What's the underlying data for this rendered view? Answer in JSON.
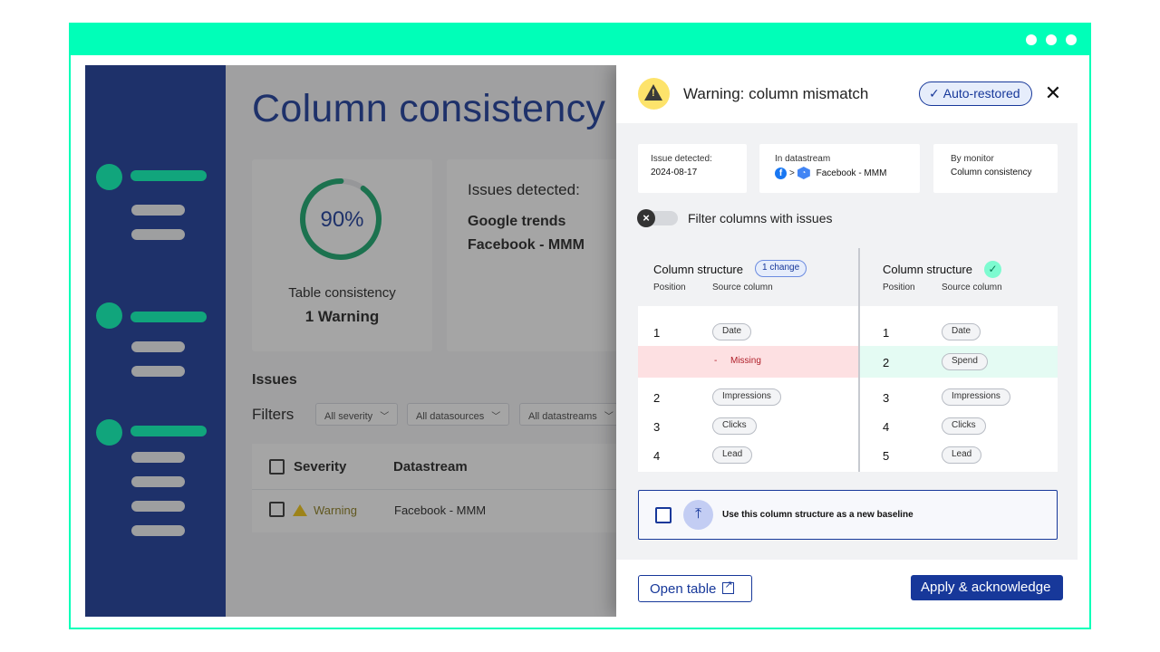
{
  "page": {
    "title": "Column consistency r",
    "consistency": {
      "percent": "90%",
      "percent_value": 0.9,
      "label": "Table consistency",
      "value": "1 Warning"
    },
    "issues_card": {
      "label": "Issues detected:",
      "items": [
        "Google trends",
        "Facebook - MMM"
      ]
    },
    "section_title": "Issues",
    "filters": {
      "label": "Filters",
      "options": [
        "All severity",
        "All datasources",
        "All datastreams"
      ]
    },
    "table": {
      "headers": [
        "Severity",
        "Datastream"
      ],
      "rows": [
        {
          "severity": "Warning",
          "datastream": "Facebook - MMM"
        }
      ]
    }
  },
  "drawer": {
    "title": "Warning: column mismatch",
    "status": "Auto-restored",
    "close": "✕",
    "info": {
      "detected_label": "Issue detected:",
      "detected_value": "2024-08-17",
      "datastream_label": "In datastream",
      "datastream_value": "Facebook - MMM",
      "monitor_label": "By monitor",
      "monitor_value": "Column consistency"
    },
    "filter_toggle_label": "Filter columns with issues",
    "left": {
      "title": "Column structure",
      "badge": "1 change",
      "position_header": "Position",
      "source_header": "Source column",
      "rows": [
        {
          "pos": "1",
          "col": "Date"
        },
        {
          "pos": "-",
          "col": "Missing"
        },
        {
          "pos": "2",
          "col": "Impressions"
        },
        {
          "pos": "3",
          "col": "Clicks"
        },
        {
          "pos": "4",
          "col": "Lead"
        }
      ]
    },
    "right": {
      "title": "Column structure",
      "position_header": "Position",
      "source_header": "Source column",
      "rows": [
        {
          "pos": "1",
          "col": "Date"
        },
        {
          "pos": "2",
          "col": "Spend"
        },
        {
          "pos": "3",
          "col": "Impressions"
        },
        {
          "pos": "4",
          "col": "Clicks"
        },
        {
          "pos": "5",
          "col": "Lead"
        }
      ]
    },
    "baseline_label": "Use this column structure as a new baseline",
    "open_table": "Open table",
    "apply": "Apply & acknowledge"
  },
  "colors": {
    "brand": "#17389a",
    "accent": "#00ffb8",
    "warning": "#fde36b",
    "missing_row": "#fde0e2",
    "added_row": "#e4fbf3"
  },
  "icons": [
    "warning-icon",
    "check-icon",
    "close-icon",
    "facebook-icon",
    "google-analytics-icon",
    "toggle-x-icon",
    "upload-icon",
    "external-link-icon",
    "chevron-down-icon"
  ]
}
